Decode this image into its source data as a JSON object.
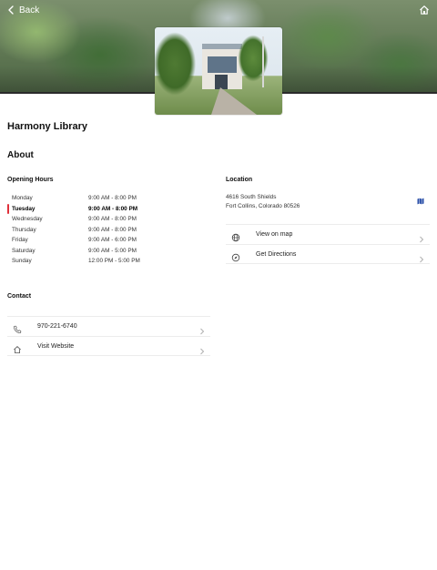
{
  "header": {
    "back_label": "Back"
  },
  "library": {
    "name": "Harmony Library"
  },
  "about": {
    "heading": "About"
  },
  "opening_hours": {
    "heading": "Opening Hours",
    "days": [
      {
        "day": "Monday",
        "hours": "9:00 AM - 8:00 PM",
        "today": false
      },
      {
        "day": "Tuesday",
        "hours": "9:00 AM - 8:00 PM",
        "today": true
      },
      {
        "day": "Wednesday",
        "hours": "9:00 AM - 8:00 PM",
        "today": false
      },
      {
        "day": "Thursday",
        "hours": "9:00 AM - 8:00 PM",
        "today": false
      },
      {
        "day": "Friday",
        "hours": "9:00 AM - 6:00 PM",
        "today": false
      },
      {
        "day": "Saturday",
        "hours": "9:00 AM - 5:00 PM",
        "today": false
      },
      {
        "day": "Sunday",
        "hours": "12:00 PM - 5:00 PM",
        "today": false
      }
    ]
  },
  "location": {
    "heading": "Location",
    "address_line1": "4616 South Shields",
    "address_line2": "Fort Collins, Colorado 80526",
    "view_on_map_label": "View on map",
    "get_directions_label": "Get Directions"
  },
  "contact": {
    "heading": "Contact",
    "phone": "970-221-6740",
    "website_label": "Visit Website"
  },
  "colors": {
    "today_marker": "#e0303a",
    "map_icon": "#2a4fa8",
    "divider": "#ececec"
  },
  "icons": {
    "back": "chevron-left-icon",
    "home": "home-icon",
    "map": "map-icon",
    "globe": "globe-icon",
    "directions": "compass-icon",
    "phone": "phone-icon",
    "website": "home-icon",
    "chevron": "chevron-right-icon"
  }
}
